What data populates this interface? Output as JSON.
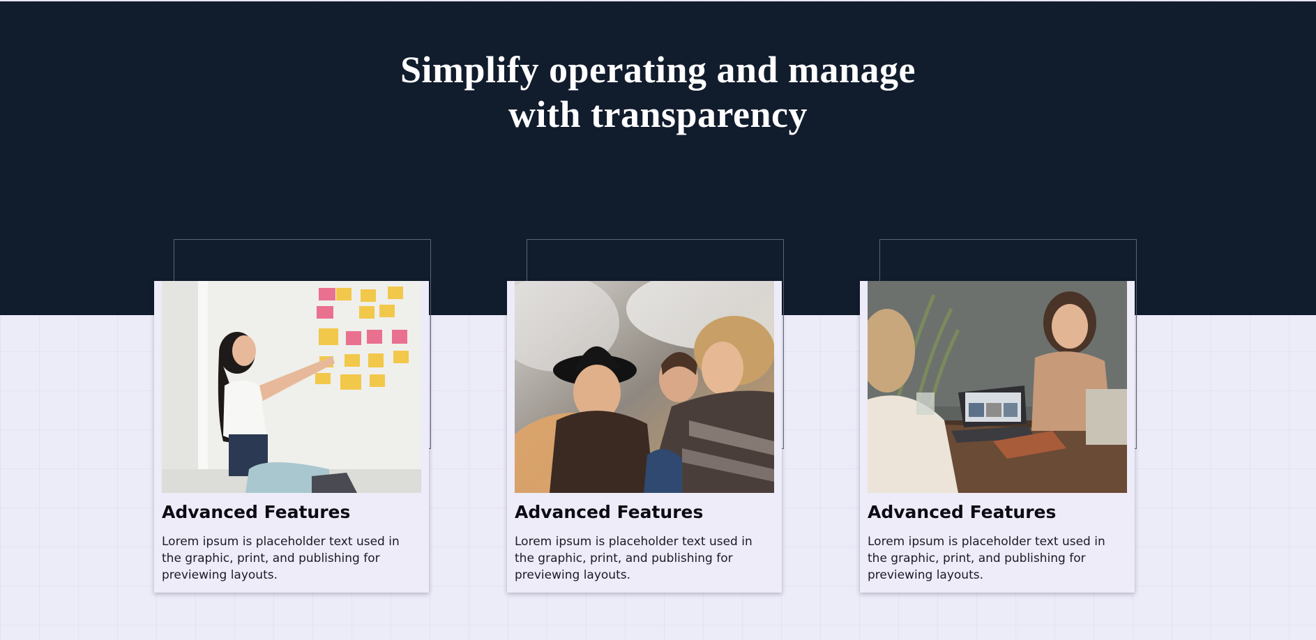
{
  "hero": {
    "title_line1": "Simplify operating and manage",
    "title_line2": "with transparency"
  },
  "cards": [
    {
      "title": "Advanced Features",
      "text": "Lorem ipsum is placeholder text used in the graphic, print, and publishing for previewing layouts.",
      "image": "woman-presenting-sticky-notes-photo"
    },
    {
      "title": "Advanced Features",
      "text": "Lorem ipsum is placeholder text used in the graphic, print, and publishing for previewing layouts.",
      "image": "smiling-women-group-photo"
    },
    {
      "title": "Advanced Features",
      "text": "Lorem ipsum is placeholder text used in the graphic, print, and publishing for previewing layouts.",
      "image": "women-laughing-at-laptop-photo"
    }
  ],
  "colors": {
    "hero_bg": "#111c2d",
    "page_bg": "#ecebf8",
    "card_bg": "#edecf8"
  }
}
